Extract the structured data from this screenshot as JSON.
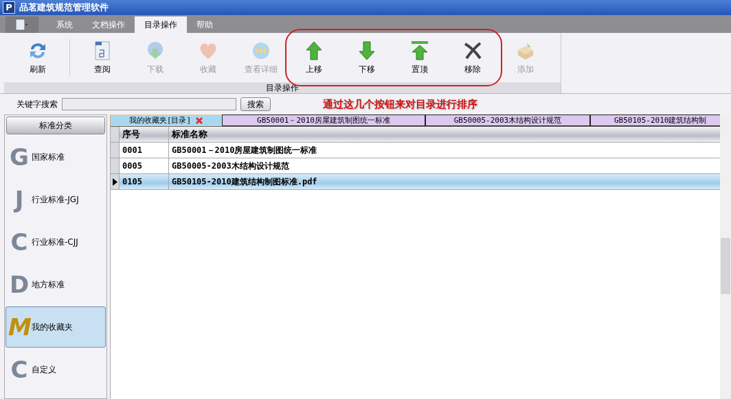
{
  "window": {
    "logo": "P",
    "title": "品茗建筑规范管理软件"
  },
  "menu_tabs": [
    {
      "kind": "app",
      "selected": false
    },
    {
      "label": "系统",
      "kind": "tab",
      "selected": false
    },
    {
      "label": "文档操作",
      "kind": "tab",
      "selected": false
    },
    {
      "label": "目录操作",
      "kind": "tab",
      "selected": true
    },
    {
      "label": "帮助",
      "kind": "tab",
      "selected": false
    }
  ],
  "ribbon": {
    "groups": [
      {
        "label": "目录操作",
        "buttons": [
          {
            "label": "刷新",
            "disabled": false
          },
          {
            "label": "查阅",
            "disabled": false
          },
          {
            "label": "下载",
            "disabled": true
          },
          {
            "label": "收藏",
            "disabled": true
          },
          {
            "label": "查看详细",
            "disabled": true
          },
          {
            "label": "上移",
            "disabled": false
          },
          {
            "label": "下移",
            "disabled": false
          },
          {
            "label": "置顶",
            "disabled": false
          },
          {
            "label": "移除",
            "disabled": false
          },
          {
            "label": "添加",
            "disabled": true
          }
        ]
      }
    ]
  },
  "search": {
    "label": "关键字搜索",
    "button": "搜索"
  },
  "annotation": {
    "text": "通过这几个按钮来对目录进行排序"
  },
  "sidebar": {
    "header": "标准分类",
    "items": [
      {
        "letter": "G",
        "label": "国家标准",
        "selected": false
      },
      {
        "letter": "J",
        "label": "行业标准-JGJ",
        "selected": false
      },
      {
        "letter": "C",
        "label": "行业标准-CJJ",
        "selected": false
      },
      {
        "letter": "D",
        "label": "地方标准",
        "selected": false
      },
      {
        "letter": "M",
        "label": "我的收藏夹",
        "selected": true
      },
      {
        "letter": "C",
        "label": "自定义",
        "selected": false
      }
    ]
  },
  "doc_tabs": [
    {
      "label": "我的收藏夹[目录]",
      "selected": true,
      "closable": true
    },
    {
      "label": "GB50001－2010房屋建筑制图统一标准",
      "selected": false,
      "closable": false
    },
    {
      "label": "GB50005-2003木结构设计规范",
      "selected": false,
      "closable": false
    },
    {
      "label": "GB50105-2010建筑结构制",
      "selected": false,
      "closable": false
    }
  ],
  "table": {
    "columns": [
      "序号",
      "标准名称"
    ],
    "rows": [
      {
        "cells": [
          "0001",
          "GB50001－2010房屋建筑制图统一标准"
        ],
        "selected": false
      },
      {
        "cells": [
          "0005",
          "GB50005-2003木结构设计规范"
        ],
        "selected": false
      },
      {
        "cells": [
          "0105",
          "GB50105-2010建筑结构制图标准.pdf"
        ],
        "selected": true
      }
    ]
  }
}
